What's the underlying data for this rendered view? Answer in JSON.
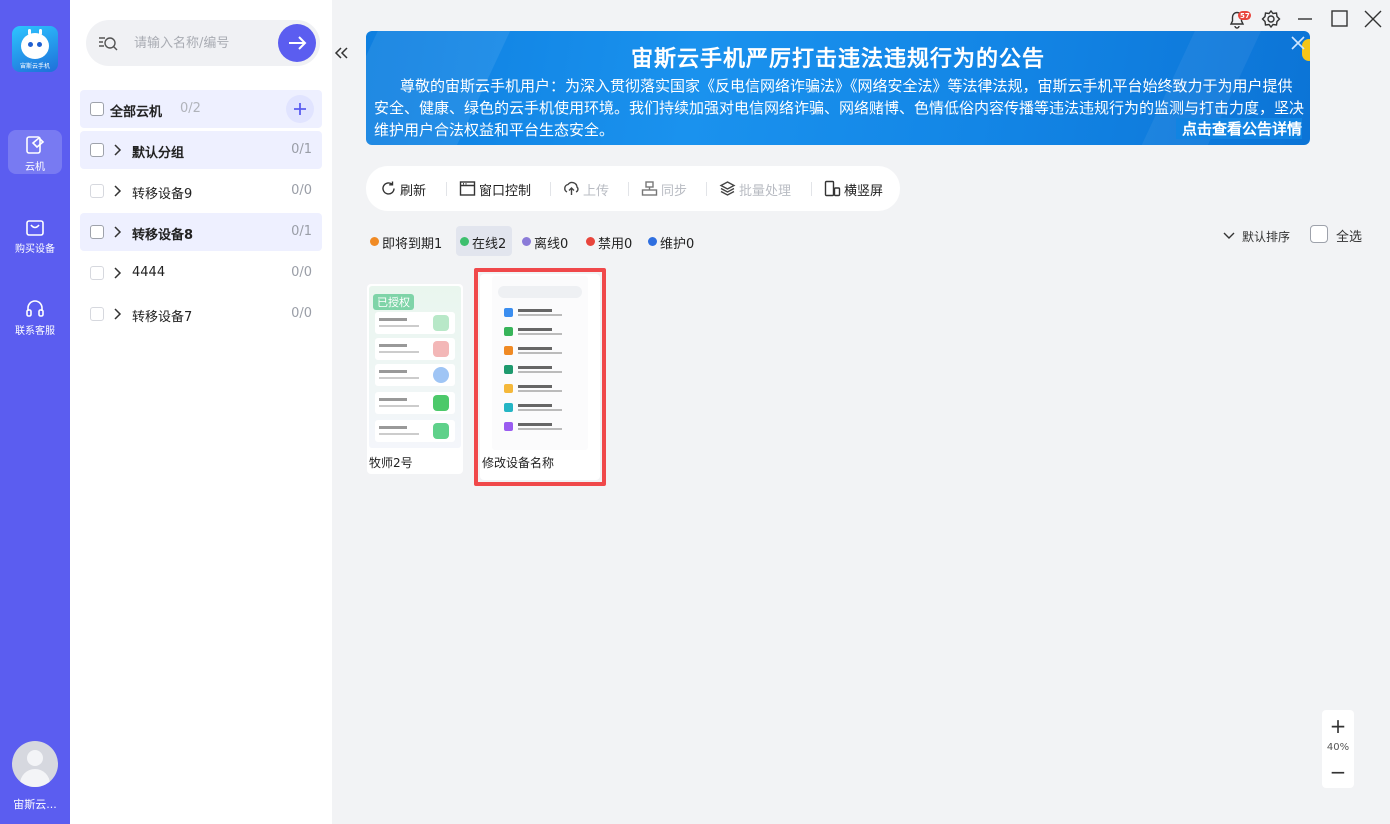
{
  "app": {
    "logo_text": "宙斯云手机",
    "user_name": "宙斯云..."
  },
  "rail": {
    "items": [
      {
        "label": "云机",
        "icon": "cloud-phone-icon",
        "active": true
      },
      {
        "label": "购买设备",
        "icon": "shopping-bag-icon",
        "active": false
      },
      {
        "label": "联系客服",
        "icon": "headset-icon",
        "active": false
      }
    ]
  },
  "search": {
    "placeholder": "请输入名称/编号",
    "value": ""
  },
  "groups": {
    "all_label": "全部云机",
    "all_count": "0/2",
    "items": [
      {
        "name": "默认分组",
        "count": "0/1",
        "bold": true
      },
      {
        "name": "转移设备9",
        "count": "0/0",
        "bold": false
      },
      {
        "name": "转移设备8",
        "count": "0/1",
        "bold": true
      },
      {
        "name": "4444",
        "count": "0/0",
        "bold": false
      },
      {
        "name": "转移设备7",
        "count": "0/0",
        "bold": false
      }
    ]
  },
  "notification": {
    "badge": "57"
  },
  "banner": {
    "title": "宙斯云手机严厉打击违法违规行为的公告",
    "body": "尊敬的宙斯云手机用户：为深入贯彻落实国家《反电信网络诈骗法》《网络安全法》等法律法规，宙斯云手机平台始终致力于为用户提供安全、健康、绿色的云手机使用环境。我们持续加强对电信网络诈骗、网络赌博、色情低俗内容传播等违法违规行为的监测与打击力度，坚决维护用户合法权益和平台生态安全。",
    "more": "点击查看公告详情"
  },
  "toolbar": {
    "refresh": "刷新",
    "window_control": "窗口控制",
    "upload": "上传",
    "sync": "同步",
    "batch": "批量处理",
    "orientation": "横竖屏"
  },
  "status_filters": [
    {
      "label": "即将到期1",
      "color": "#f08a24"
    },
    {
      "label": "在线2",
      "color": "#3dbf6e"
    },
    {
      "label": "离线0",
      "color": "#8b7bd8"
    },
    {
      "label": "禁用0",
      "color": "#e8453c"
    },
    {
      "label": "维护0",
      "color": "#2f6fe0"
    }
  ],
  "sort": {
    "label": "默认排序"
  },
  "select_all": {
    "label": "全选"
  },
  "devices": [
    {
      "name": "牧师2号",
      "badge": "已授权"
    },
    {
      "name": "修改设备名称"
    }
  ],
  "zoom": {
    "value": "40%",
    "plus": "+",
    "minus": "−"
  }
}
